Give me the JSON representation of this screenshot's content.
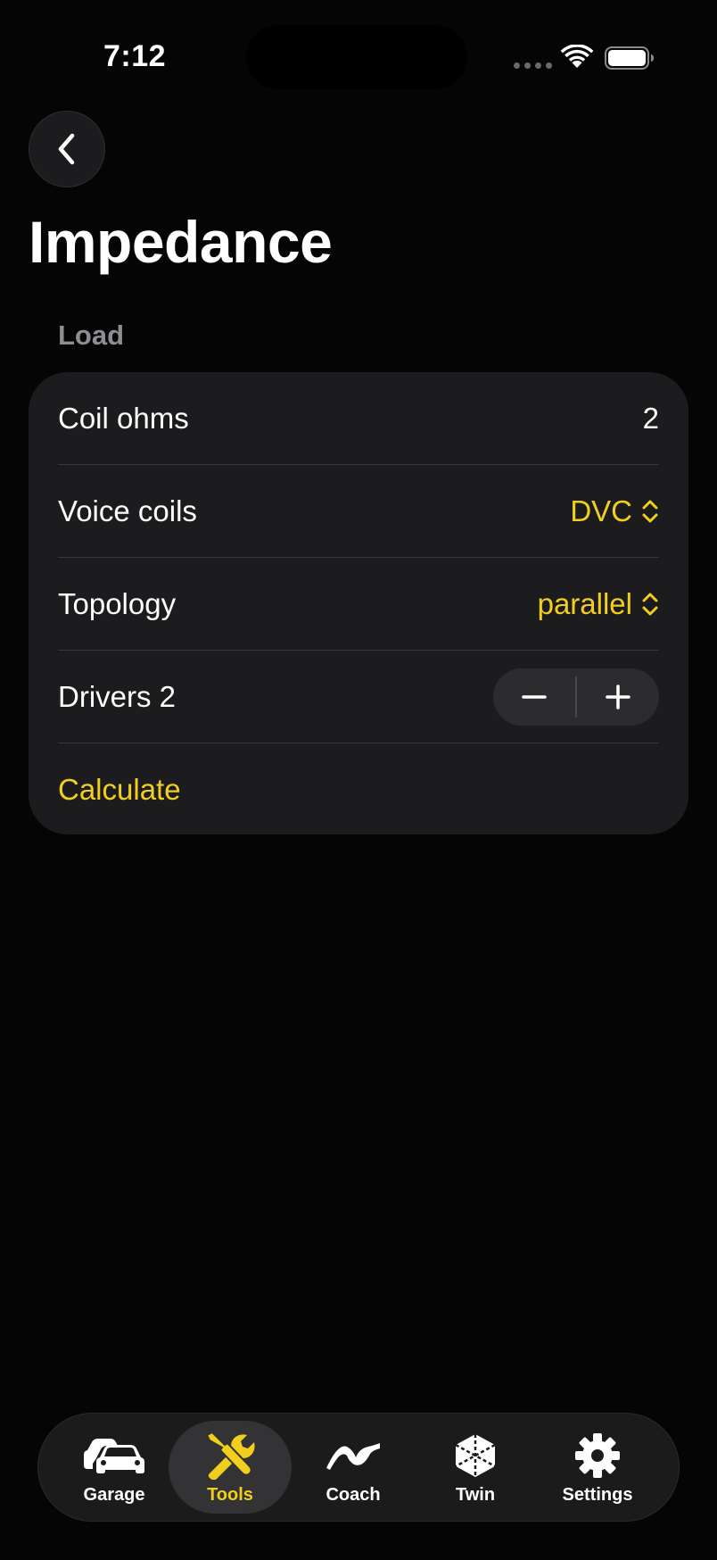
{
  "status_bar": {
    "time": "7:12"
  },
  "header": {
    "back_icon": "chevron-left-icon",
    "title": "Impedance"
  },
  "section": {
    "header": "Load"
  },
  "form": {
    "coil_ohms": {
      "label": "Coil ohms",
      "value": "2"
    },
    "voice_coils": {
      "label": "Voice coils",
      "value": "DVC"
    },
    "topology": {
      "label": "Topology",
      "value": "parallel"
    },
    "drivers": {
      "label": "Drivers 2",
      "decrement_icon": "minus-icon",
      "increment_icon": "plus-icon"
    },
    "calculate_label": "Calculate"
  },
  "tab_bar": {
    "active": "Tools",
    "items": [
      {
        "label": "Garage",
        "icon": "cars-icon"
      },
      {
        "label": "Tools",
        "icon": "tools-icon"
      },
      {
        "label": "Coach",
        "icon": "waveform-icon"
      },
      {
        "label": "Twin",
        "icon": "cube-icon"
      },
      {
        "label": "Settings",
        "icon": "gear-icon"
      }
    ]
  },
  "colors": {
    "accent": "#f2cf1d",
    "background": "#050505",
    "card": "#1c1c1e",
    "secondary_text": "#8d8d92"
  }
}
